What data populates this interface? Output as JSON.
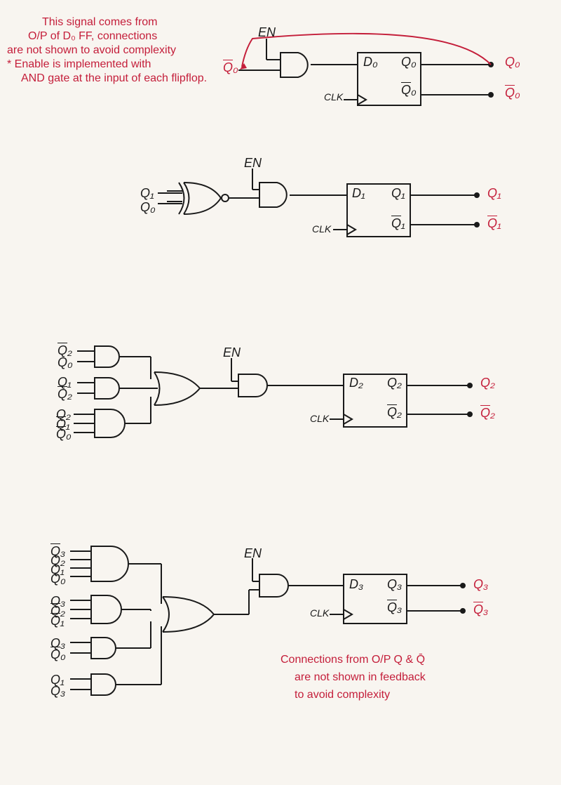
{
  "notes": {
    "top1": "This signal comes from",
    "top2": "O/P of D₀ FF, connections",
    "top3": "are not shown to avoid complexity",
    "top4": "* Enable is implemented with",
    "top5": "AND gate at the input of each flipflop.",
    "bottom1": "Connections from O/P Q & Q̄",
    "bottom2": "are not shown in feedback",
    "bottom3": "to avoid complexity"
  },
  "labels": {
    "EN": "EN",
    "CLK": "CLK",
    "Q0": "Q₀",
    "Q0bar": "Q̄₀",
    "Q1": "Q₁",
    "Q1bar": "Q̄₁",
    "Q2": "Q₂",
    "Q2bar": "Q̄₂",
    "Q3": "Q₃",
    "Q3bar": "Q̄₃",
    "D0": "D₀",
    "D1": "D₁",
    "D2": "D₂",
    "D3": "D₃"
  },
  "stages": [
    {
      "id": 0,
      "inputs": [
        "Q̄₀"
      ],
      "gate_type": "none",
      "ff": {
        "D": "D₀",
        "Q": "Q₀",
        "Qbar": "Q̄₀"
      }
    },
    {
      "id": 1,
      "inputs": [
        "Q₁",
        "Q₀"
      ],
      "gate_type": "XNOR",
      "ff": {
        "D": "D₁",
        "Q": "Q₁",
        "Qbar": "Q̄₁"
      }
    },
    {
      "id": 2,
      "input_groups": [
        [
          "Q̄₂",
          "Q₀"
        ],
        [
          "Q₁",
          "Q̄₂"
        ],
        [
          "Q₂",
          "Q̄₁",
          "Q̄₀"
        ]
      ],
      "gate_type": "AND-OR",
      "ff": {
        "D": "D₂",
        "Q": "Q₂",
        "Qbar": "Q̄₂"
      }
    },
    {
      "id": 3,
      "input_groups": [
        [
          "Q̄₃",
          "Q₂",
          "Q₁",
          "Q₀"
        ],
        [
          "Q₃",
          "Q̄₂",
          "Q̄₁"
        ],
        [
          "Q₃",
          "Q̄₀"
        ],
        [
          "Q₁",
          "Q₃"
        ]
      ],
      "gate_type": "AND-OR",
      "ff": {
        "D": "D₃",
        "Q": "Q₃",
        "Qbar": "Q̄₃"
      }
    }
  ]
}
